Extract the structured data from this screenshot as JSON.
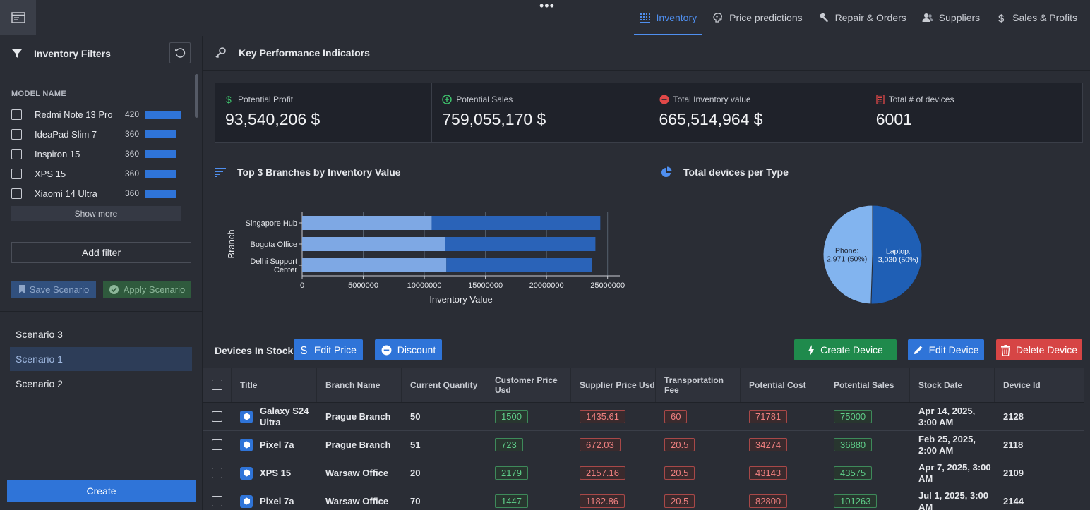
{
  "nav": {
    "tabs": [
      {
        "label": "Inventory",
        "icon": "inventory-grid-icon",
        "active": true
      },
      {
        "label": "Price predictions",
        "icon": "brain-icon"
      },
      {
        "label": "Repair & Orders",
        "icon": "hammer-icon"
      },
      {
        "label": "Suppliers",
        "icon": "users-icon"
      },
      {
        "label": "Sales & Profits",
        "icon": "dollar-icon"
      }
    ]
  },
  "sidebar": {
    "title": "Inventory Filters",
    "model_label": "MODEL NAME",
    "models": [
      {
        "name": "Redmi Note 13 Pro",
        "count": "420",
        "bar_fraction": 1.0
      },
      {
        "name": "IdeaPad Slim 7",
        "count": "360",
        "bar_fraction": 0.86
      },
      {
        "name": "Inspiron 15",
        "count": "360",
        "bar_fraction": 0.86
      },
      {
        "name": "XPS 15",
        "count": "360",
        "bar_fraction": 0.86
      },
      {
        "name": "Xiaomi 14 Ultra",
        "count": "360",
        "bar_fraction": 0.86
      }
    ],
    "show_more": "Show more",
    "add_filter": "Add filter",
    "save_scenario": "Save Scenario",
    "apply_scenario": "Apply Scenario",
    "scenarios": [
      "Scenario 3",
      "Scenario 1",
      "Scenario 2"
    ],
    "selected_scenario": "Scenario 1",
    "create": "Create"
  },
  "kpi": {
    "title": "Key Performance Indicators",
    "cards": [
      {
        "label": "Potential Profit",
        "value": "93,540,206 $",
        "icon": "dollar-icon",
        "color": "#3ec46d"
      },
      {
        "label": "Potential Sales",
        "value": "759,055,170 $",
        "icon": "plus-circle-icon",
        "color": "#3ec46d"
      },
      {
        "label": "Total Inventory value",
        "value": "665,514,964 $",
        "icon": "minus-circle-icon",
        "color": "#e04848"
      },
      {
        "label": "Total # of devices",
        "value": "6001",
        "icon": "calculator-icon",
        "color": "#e04848"
      }
    ]
  },
  "branches_chart": {
    "title": "Top 3 Branches by Inventory Value"
  },
  "devices_chart": {
    "title": "Total devices per Type"
  },
  "chart_data": [
    {
      "type": "bar",
      "orientation": "horizontal",
      "stacked": true,
      "categories": [
        "Singapore Hub",
        "Bogota Office",
        "Delhi Support Center"
      ],
      "series": [
        {
          "values": [
            10600000,
            11700000,
            11800000
          ],
          "color": "#7ea8e4"
        },
        {
          "values": [
            13800000,
            12300000,
            11900000
          ],
          "color": "#2a63b8"
        }
      ],
      "xlabel": "Inventory Value",
      "ylabel": "Branch",
      "xlim": [
        0,
        26000000
      ],
      "xticks": [
        "0",
        "5000000",
        "10000000",
        "15000000",
        "20000000",
        "25000000"
      ],
      "grid": true
    },
    {
      "type": "pie",
      "slices": [
        {
          "label": "Laptop:",
          "sub": "3,030 (50%)",
          "value": 3030,
          "color": "#1f5fb5"
        },
        {
          "label": "Phone:",
          "sub": "2,971 (50%)",
          "value": 2971,
          "color": "#82b4ef"
        }
      ]
    }
  ],
  "devices": {
    "title": "Devices In Stock",
    "edit_price": "Edit Price",
    "discount": "Discount",
    "create_device": "Create Device",
    "edit_device": "Edit Device",
    "delete_device": "Delete Device",
    "columns": [
      "Title",
      "Branch Name",
      "Current Quantity",
      "Customer Price Usd",
      "Supplier Price Usd",
      "Transportation Fee",
      "Potential Cost",
      "Potential Sales",
      "Stock Date",
      "Device Id"
    ],
    "rows": [
      {
        "title": "Galaxy S24 Ultra",
        "branch": "Prague Branch",
        "qty": "50",
        "customer": "1500",
        "supplier": "1435.61",
        "fee": "60",
        "cost": "71781",
        "sales": "75000",
        "date": "Apr 14, 2025, 3:00 AM",
        "id": "2128"
      },
      {
        "title": "Pixel 7a",
        "branch": "Prague Branch",
        "qty": "51",
        "customer": "723",
        "supplier": "672.03",
        "fee": "20.5",
        "cost": "34274",
        "sales": "36880",
        "date": "Feb 25, 2025, 2:00 AM",
        "id": "2118"
      },
      {
        "title": "XPS 15",
        "branch": "Warsaw Office",
        "qty": "20",
        "customer": "2179",
        "supplier": "2157.16",
        "fee": "20.5",
        "cost": "43143",
        "sales": "43575",
        "date": "Apr 7, 2025, 3:00 AM",
        "id": "2109"
      },
      {
        "title": "Pixel 7a",
        "branch": "Warsaw Office",
        "qty": "70",
        "customer": "1447",
        "supplier": "1182.86",
        "fee": "20.5",
        "cost": "82800",
        "sales": "101263",
        "date": "Jul 1, 2025, 3:00 AM",
        "id": "2144"
      }
    ]
  }
}
